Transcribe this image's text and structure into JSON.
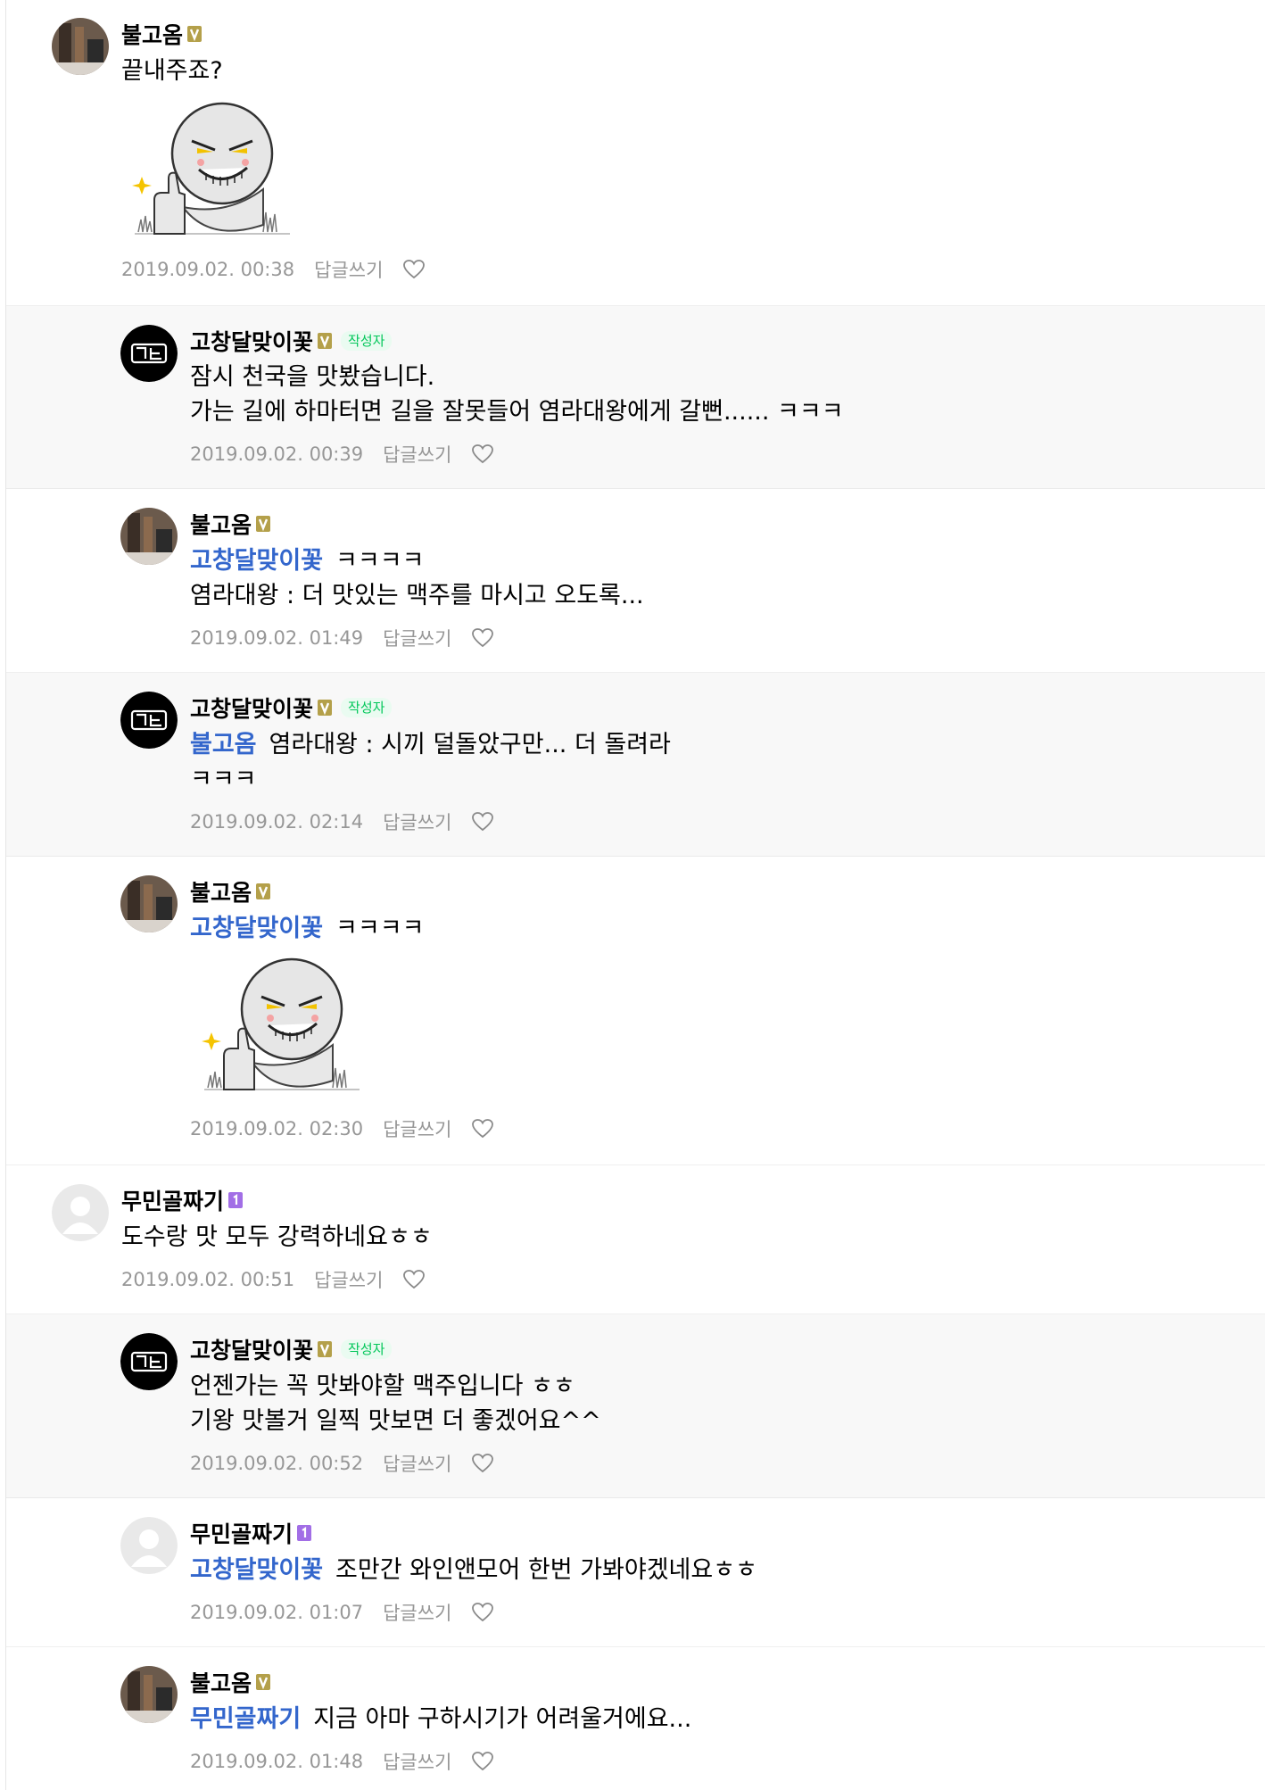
{
  "reply_label": "답글쓰기",
  "writer_badge": "작성자",
  "colors": {
    "mention": "#3366cc",
    "meta": "#979797",
    "reply_bg": "#f8f8f8",
    "writer_green": "#03c75a",
    "level_gold": "#b4a04a",
    "level_purple": "#a26ee6"
  },
  "icons": {
    "heart": "heart-outline-icon",
    "level_v": "level-v-icon",
    "level_1": "level-1-icon"
  },
  "comments": [
    {
      "author": "불고옴",
      "badge": "V",
      "is_reply": false,
      "mention": "",
      "lines": [
        "끝내주죠?"
      ],
      "has_sticker": true,
      "time": "2019.09.02. 00:38"
    },
    {
      "author": "고창달맞이꽃",
      "badge": "V",
      "is_writer": true,
      "is_reply": true,
      "mention": "",
      "lines": [
        "잠시 천국을 맛봤습니다.",
        "가는 길에 하마터면 길을 잘못들어 염라대왕에게 갈뻔...... ㅋㅋㅋ"
      ],
      "has_sticker": false,
      "time": "2019.09.02. 00:39"
    },
    {
      "author": "불고옴",
      "badge": "V",
      "is_reply": true,
      "mention": "고창달맞이꽃",
      "lines": [
        "ㅋㅋㅋㅋ",
        "염라대왕 : 더 맛있는 맥주를 마시고 오도록..."
      ],
      "has_sticker": false,
      "time": "2019.09.02. 01:49"
    },
    {
      "author": "고창달맞이꽃",
      "badge": "V",
      "is_writer": true,
      "is_reply": true,
      "mention": "불고옴",
      "lines": [
        "염라대왕 : 시끼 덜돌았구만... 더 돌려라",
        "ㅋㅋㅋ"
      ],
      "has_sticker": false,
      "time": "2019.09.02. 02:14"
    },
    {
      "author": "불고옴",
      "badge": "V",
      "is_reply": true,
      "mention": "고창달맞이꽃",
      "lines": [
        "ㅋㅋㅋㅋ"
      ],
      "has_sticker": true,
      "time": "2019.09.02. 02:30"
    },
    {
      "author": "무민골짜기",
      "badge": "1",
      "is_reply": false,
      "mention": "",
      "lines": [
        "도수랑 맛 모두 강력하네요ㅎㅎ"
      ],
      "has_sticker": false,
      "time": "2019.09.02. 00:51"
    },
    {
      "author": "고창달맞이꽃",
      "badge": "V",
      "is_writer": true,
      "is_reply": true,
      "mention": "",
      "lines": [
        "언젠가는 꼭 맛봐야할 맥주입니다 ㅎㅎ",
        "기왕 맛볼거 일찍 맛보면 더 좋겠어요^^"
      ],
      "has_sticker": false,
      "time": "2019.09.02. 00:52"
    },
    {
      "author": "무민골짜기",
      "badge": "1",
      "is_reply": true,
      "mention": "고창달맞이꽃",
      "lines": [
        "조만간 와인앤모어 한번 가봐야겠네요ㅎㅎ"
      ],
      "has_sticker": false,
      "time": "2019.09.02. 01:07"
    },
    {
      "author": "불고옴",
      "badge": "V",
      "is_reply": true,
      "mention": "무민골짜기",
      "lines": [
        "지금 아마 구하시기가 어려울거에요..."
      ],
      "has_sticker": false,
      "time": "2019.09.02. 01:48"
    }
  ]
}
